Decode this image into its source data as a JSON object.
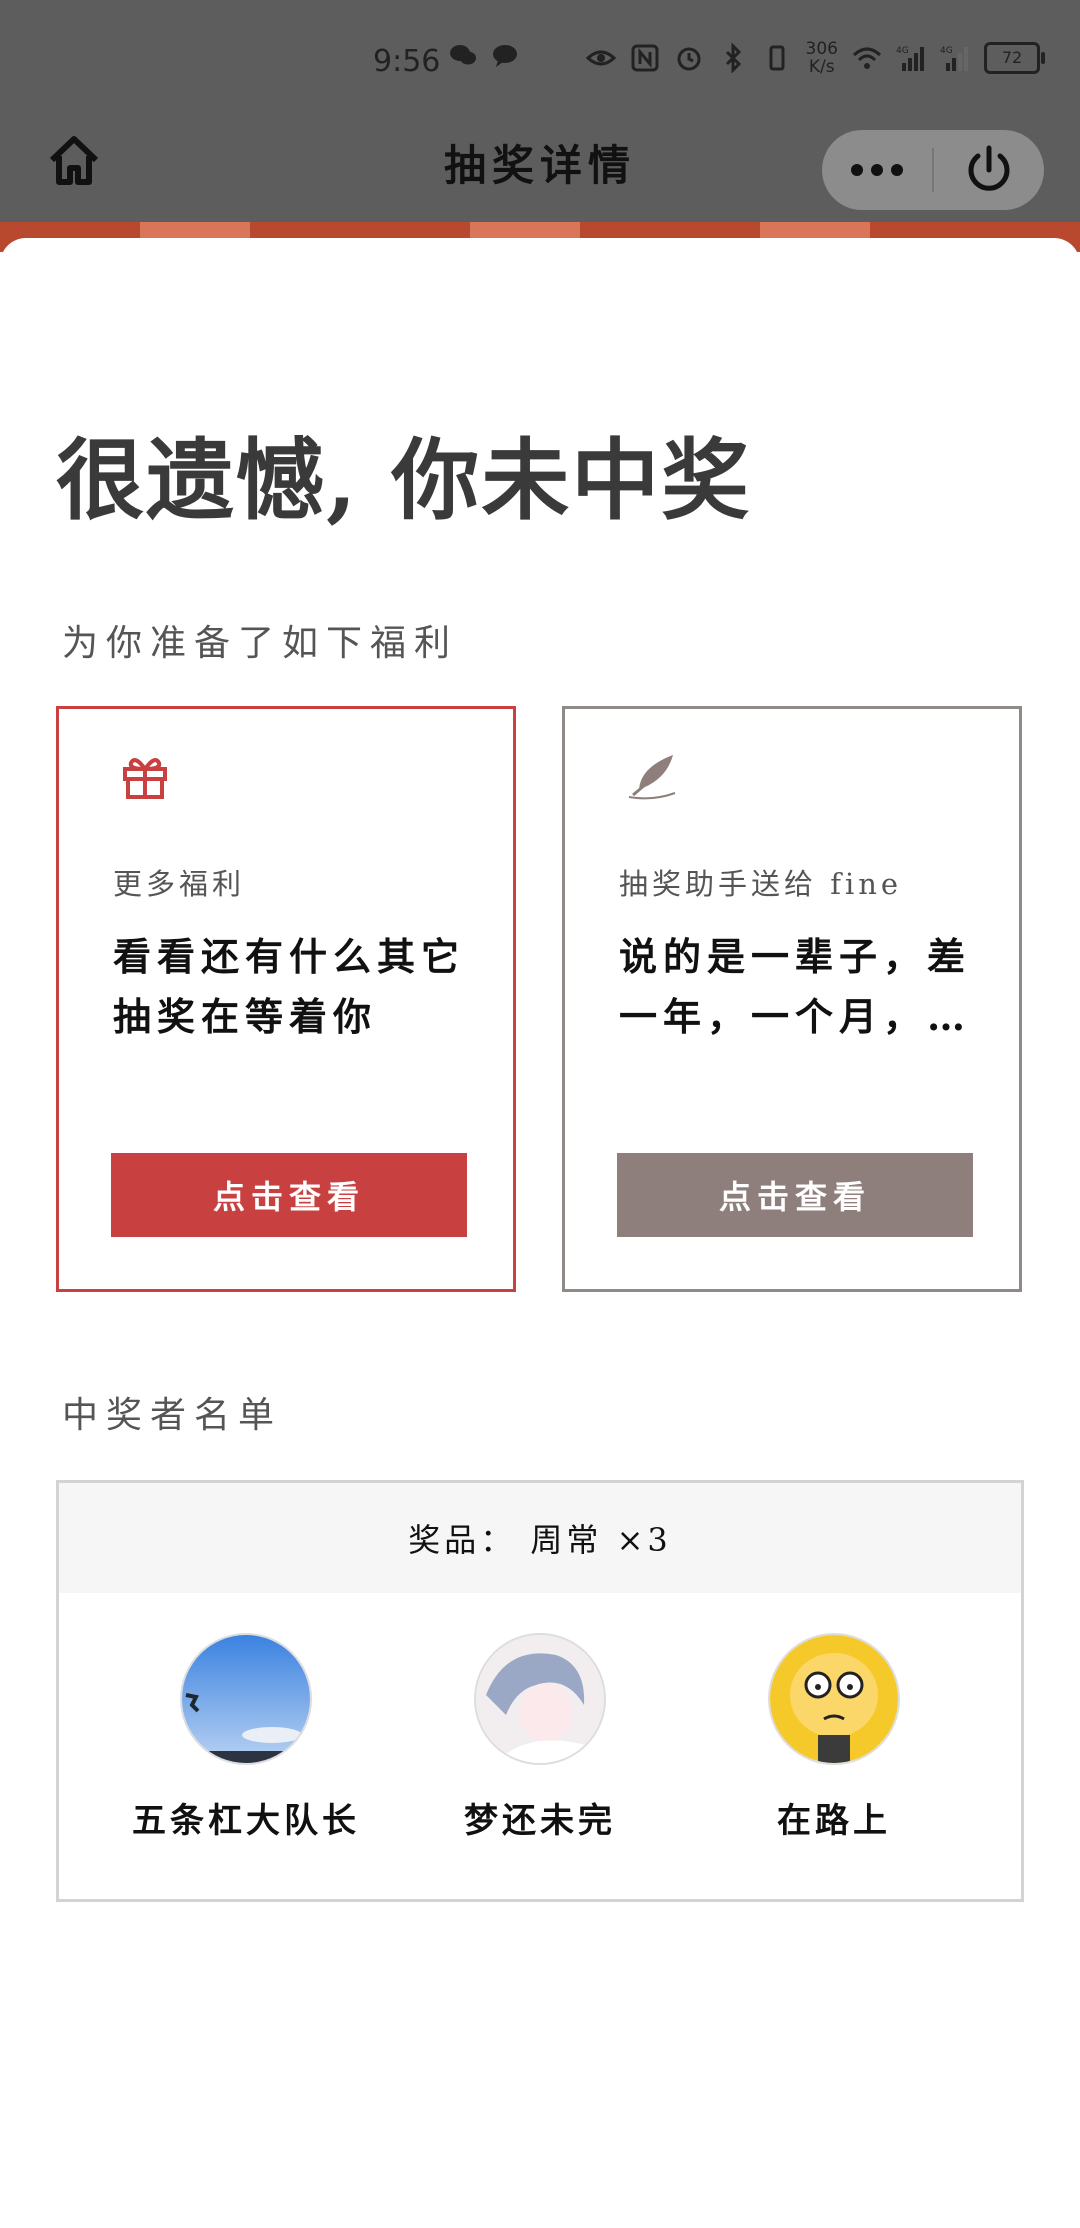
{
  "status_bar": {
    "time": "9:56",
    "net_speed_value": "306",
    "net_speed_unit": "K/s",
    "signal_1_label": "4G",
    "signal_2_label": "4G",
    "battery": "72"
  },
  "nav": {
    "title": "抽奖详情"
  },
  "result": {
    "headline": "很遗憾, 你未中奖",
    "benefits_label": "为你准备了如下福利"
  },
  "cards": [
    {
      "subtitle": "更多福利",
      "description": "看看还有什么其它抽奖在等着你",
      "button": "点击查看",
      "accent": "#c94040",
      "icon": "gift-icon"
    },
    {
      "subtitle": "抽奖助手送给 fine",
      "description": "说的是一辈子，差一年，一个月，…",
      "button": "点击查看",
      "accent": "#8f7f7c",
      "icon": "feather-icon"
    }
  ],
  "winners_section": {
    "label": "中奖者名单",
    "prize": "奖品： 周常 ×3",
    "winners": [
      {
        "name": "五条杠大队长"
      },
      {
        "name": "梦还未完"
      },
      {
        "name": "在路上"
      }
    ]
  }
}
